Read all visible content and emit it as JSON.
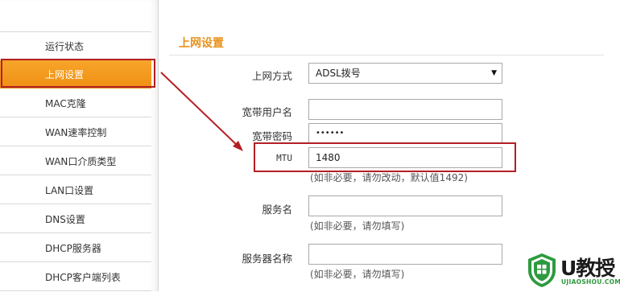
{
  "sidebar": {
    "items": [
      {
        "label": "运行状态"
      },
      {
        "label": "上网设置"
      },
      {
        "label": "MAC克隆"
      },
      {
        "label": "WAN速率控制"
      },
      {
        "label": "WAN口介质类型"
      },
      {
        "label": "LAN口设置"
      },
      {
        "label": "DNS设置"
      },
      {
        "label": "DHCP服务器"
      },
      {
        "label": "DHCP客户端列表"
      }
    ],
    "active_item": "上网设置"
  },
  "main": {
    "section_title": "上网设置",
    "connection_type": {
      "label": "上网方式",
      "value": "ADSL拨号"
    },
    "username": {
      "label": "宽带用户名",
      "value": ""
    },
    "password": {
      "label": "宽带密码",
      "value": "••••••"
    },
    "mtu": {
      "label": "MTU",
      "value": "1480",
      "hint": "(如非必要，请勿改动，默认值1492)"
    },
    "service_name": {
      "label": "服务名",
      "value": "",
      "hint": "(如非必要，请勿填写)"
    },
    "server_name": {
      "label": "服务器名称",
      "value": "",
      "hint": "(如非必要，请勿填写)"
    }
  },
  "watermark": {
    "brand": "U教授",
    "domain": "UJIAOSHOU.COM"
  },
  "colors": {
    "accent": "#f29b1c",
    "title": "#e8911b",
    "highlight": "#b41f24",
    "watermark_green": "#2e9a3f"
  }
}
